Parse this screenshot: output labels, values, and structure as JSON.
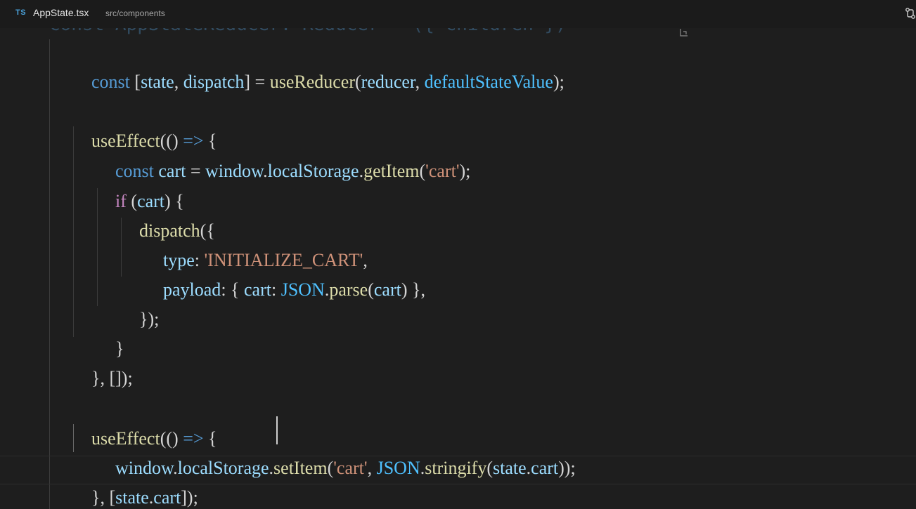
{
  "tab": {
    "language_badge": "TS",
    "file_name": "AppState.tsx",
    "file_path": "src/components"
  },
  "editor": {
    "faded_line": "const AppStateReducer: Reducer = ({ children }) ",
    "lines": [
      {
        "tokens": [
          "const",
          " [",
          "state",
          ", ",
          "dispatch",
          "] = ",
          "useReducer",
          "(",
          "reducer",
          ", ",
          "defaultStateValue",
          ");"
        ]
      },
      {
        "tokens": [
          "useEffect",
          "(() ",
          "=>",
          " {"
        ]
      },
      {
        "tokens": [
          "const",
          " ",
          "cart",
          " = ",
          "window",
          ".",
          "localStorage",
          ".",
          "getItem",
          "(",
          "'cart'",
          ");"
        ]
      },
      {
        "tokens": [
          "if",
          " (",
          "cart",
          ") {"
        ]
      },
      {
        "tokens": [
          "dispatch",
          "({"
        ]
      },
      {
        "tokens": [
          "type",
          ": ",
          "'INITIALIZE_CART'",
          ","
        ]
      },
      {
        "tokens": [
          "payload",
          ": { ",
          "cart",
          ": ",
          "JSON",
          ".",
          "parse",
          "(",
          "cart",
          ") },"
        ]
      },
      {
        "tokens": [
          "});"
        ]
      },
      {
        "tokens": [
          "}"
        ]
      },
      {
        "tokens": [
          "}, []);"
        ]
      },
      {
        "tokens": [
          "useEffect",
          "(() ",
          "=>",
          " {"
        ]
      },
      {
        "tokens": [
          "window",
          ".",
          "localStorage",
          ".",
          "setItem",
          "(",
          "'cart'",
          ", ",
          "JSON",
          ".",
          "stringify",
          "(",
          "state",
          ".",
          "cart",
          "));"
        ]
      },
      {
        "tokens": [
          "}, [",
          "state",
          ".",
          "cart",
          "]);"
        ]
      }
    ]
  }
}
